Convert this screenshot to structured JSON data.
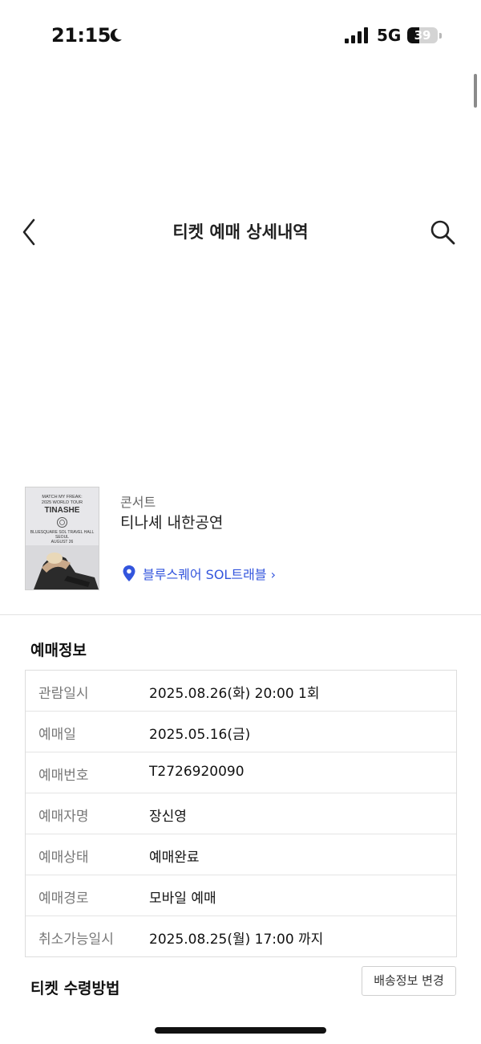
{
  "status_bar": {
    "time": "21:15",
    "network": "5G",
    "battery": "39",
    "battery_level": 0.39
  },
  "header": {
    "title": "티켓 예매 상세내역",
    "back_icon": "chevron-left-icon",
    "search_icon": "search-icon"
  },
  "show": {
    "category": "콘서트",
    "title": "티나셰 내한공연",
    "venue": "블루스퀘어 SOL트래블 ›",
    "venue_icon": "location-pin-icon",
    "venue_color": "#3355dd",
    "poster": {
      "line1": "MATCH MY FREAK:",
      "line2": "2025 WORLD TOUR",
      "artist": "TINASHE",
      "venue": "BLUESQUARE SOL TRAVEL HALL",
      "city": "SEOUL",
      "date": "AUGUST 26"
    }
  },
  "booking_info": {
    "title": "예매정보",
    "rows": [
      {
        "label": "관람일시",
        "value": "2025.08.26(화) 20:00 1회"
      },
      {
        "label": "예매일",
        "value": "2025.05.16(금)"
      },
      {
        "label": "예매번호",
        "value": "T2726920090"
      },
      {
        "label": "예매자명",
        "value": "장신영"
      },
      {
        "label": "예매상태",
        "value": "예매완료"
      },
      {
        "label": "예매경로",
        "value": "모바일 예매"
      },
      {
        "label": "취소가능일시",
        "value": "2025.08.25(월) 17:00 까지"
      }
    ]
  },
  "ticket_receipt": {
    "title": "티켓 수령방법",
    "change_button": "배송정보 변경"
  }
}
